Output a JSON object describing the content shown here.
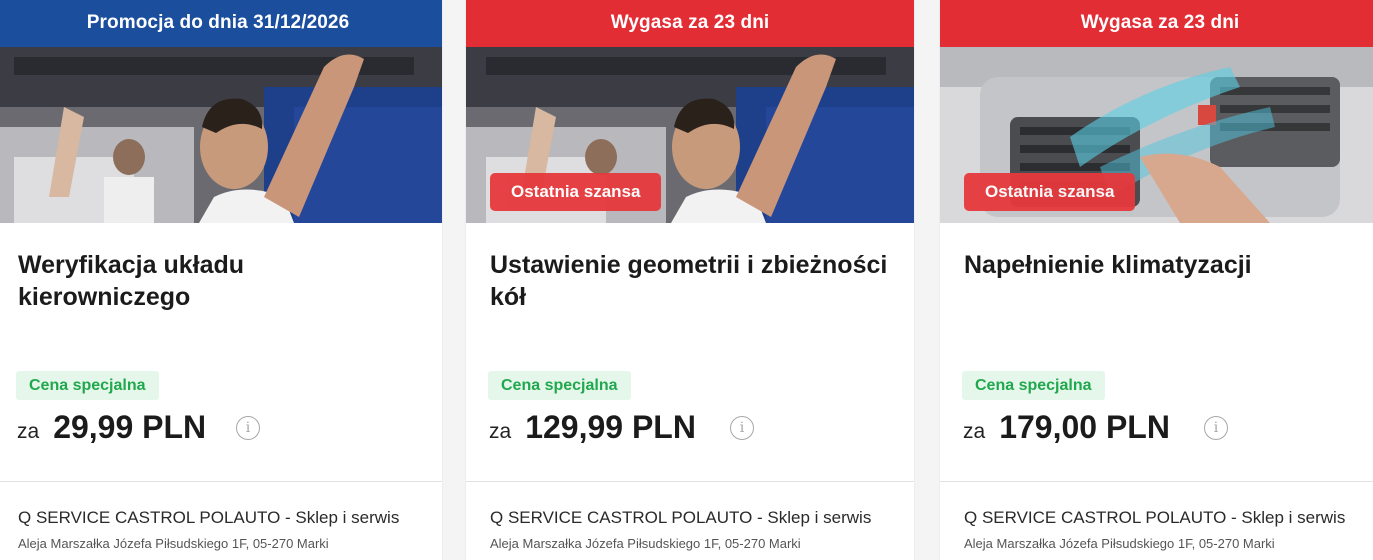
{
  "cards": [
    {
      "banner": "Promocja do dnia 31/12/2026",
      "banner_color": "#1c4e9e",
      "image": "mechanic-under-car-photo",
      "badge": "",
      "title": "Weryfikacja układu kierowniczego",
      "price_label": "Cena specjalna",
      "price_prefix": "za",
      "price": "29,99 PLN",
      "info_icon": "info-icon",
      "shop_name": "Q SERVICE CASTROL POLAUTO - Sklep i serwis",
      "address": "Aleja Marszałka Józefa Piłsudskiego 1F, 05-270 Marki"
    },
    {
      "banner": "Wygasa za 23 dni",
      "banner_color": "#e32d35",
      "image": "mechanic-under-car-photo",
      "badge": "Ostatnia szansa",
      "title": "Ustawienie geometrii i zbieżności kół",
      "price_label": "Cena specjalna",
      "price_prefix": "za",
      "price": "129,99 PLN",
      "info_icon": "info-icon",
      "shop_name": "Q SERVICE CASTROL POLAUTO - Sklep i serwis",
      "address": "Aleja Marszałka Józefa Piłsudskiego 1F, 05-270 Marki"
    },
    {
      "banner": "Wygasa za 23 dni",
      "banner_color": "#e32d35",
      "image": "car-air-vent-photo",
      "badge": "Ostatnia szansa",
      "title": "Napełnienie klimatyzacji",
      "price_label": "Cena specjalna",
      "price_prefix": "za",
      "price": "179,00 PLN",
      "info_icon": "info-icon",
      "shop_name": "Q SERVICE CASTROL POLAUTO - Sklep i serwis",
      "address": "Aleja Marszałka Józefa Piłsudskiego 1F, 05-270 Marki"
    }
  ],
  "colors": {
    "special_text": "#21a84e",
    "special_bg": "#e5f7ea",
    "chance_bg": "#e6383c"
  }
}
